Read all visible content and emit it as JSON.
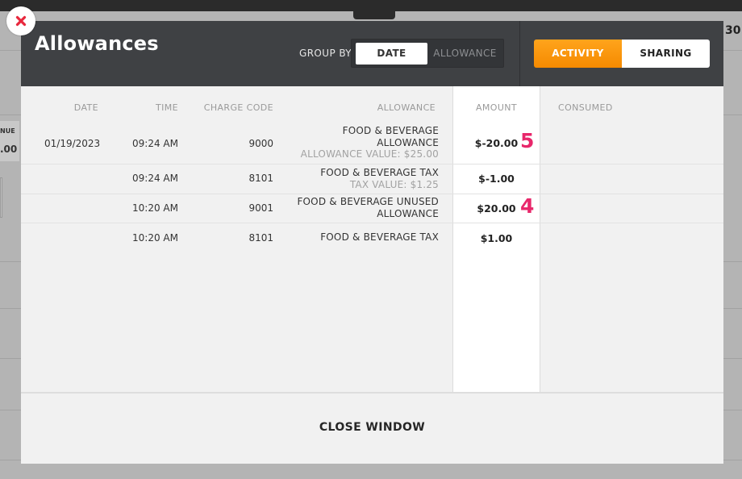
{
  "background": {
    "left_label": "NUE",
    "left_value": ".00",
    "right_label": "30"
  },
  "modal": {
    "title": "Allowances",
    "group_by": {
      "label": "GROUP BY",
      "options": [
        "DATE",
        "ALLOWANCE"
      ],
      "selected": "DATE"
    },
    "tabs": [
      {
        "label": "ACTIVITY",
        "active": true
      },
      {
        "label": "SHARING",
        "active": false
      }
    ],
    "table": {
      "headers": {
        "date": "DATE",
        "time": "TIME",
        "charge_code": "CHARGE CODE",
        "allowance": "ALLOWANCE",
        "amount": "AMOUNT",
        "consumed": "CONSUMED"
      },
      "rows": [
        {
          "date": "01/19/2023",
          "time": "09:24 AM",
          "charge_code": "9000",
          "allowance_line1": "FOOD & BEVERAGE",
          "allowance_line2": "ALLOWANCE",
          "allowance_sub": "ALLOWANCE VALUE: $25.00",
          "amount": "$-20.00",
          "badge": "5"
        },
        {
          "date": "",
          "time": "09:24 AM",
          "charge_code": "8101",
          "allowance_line1": "FOOD & BEVERAGE TAX",
          "allowance_sub": "TAX VALUE: $1.25",
          "amount": "$-1.00"
        },
        {
          "date": "",
          "time": "10:20 AM",
          "charge_code": "9001",
          "allowance_line1": "FOOD & BEVERAGE UNUSED",
          "allowance_line2": "ALLOWANCE",
          "amount": "$20.00",
          "badge": "4"
        },
        {
          "date": "",
          "time": "10:20 AM",
          "charge_code": "8101",
          "allowance_line1": "FOOD & BEVERAGE TAX",
          "amount": "$1.00"
        }
      ]
    },
    "close_window_label": "CLOSE WINDOW"
  },
  "icons": {
    "close": "close-x-icon"
  },
  "colors": {
    "header_bg": "#3f4144",
    "accent_orange": "#f7941d",
    "close_red": "#e8273c",
    "badge_pink": "#e8276b"
  }
}
